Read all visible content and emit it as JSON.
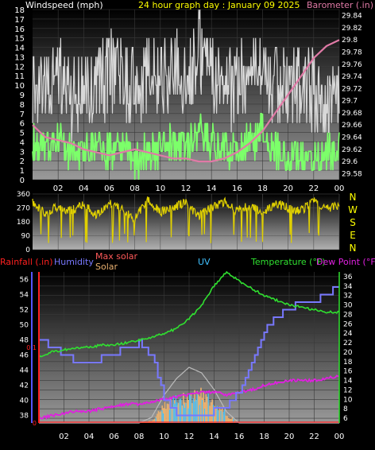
{
  "chart_data": [
    {
      "type": "line",
      "title": "24 hour graph day : January 09 2025",
      "left_axis_label": "Windspeed (mph)",
      "right_axis_label": "Barometer (.in)",
      "x_ticks": [
        "02",
        "04",
        "06",
        "08",
        "10",
        "12",
        "14",
        "16",
        "18",
        "20",
        "22",
        "00"
      ],
      "x_range_hours": [
        0,
        24
      ],
      "left_ylim": [
        0,
        18
      ],
      "left_ticks": [
        "0",
        "1",
        "2",
        "3",
        "4",
        "5",
        "6",
        "7",
        "8",
        "9",
        "10",
        "11",
        "12",
        "13",
        "14",
        "15",
        "16",
        "17",
        "18"
      ],
      "right_ylim": [
        29.57,
        29.85
      ],
      "right_ticks": [
        "29.58",
        "29.6",
        "29.62",
        "29.64",
        "29.66",
        "29.68",
        "29.7",
        "29.72",
        "29.74",
        "29.76",
        "29.78",
        "29.8",
        "29.82",
        "29.84"
      ],
      "colors": {
        "gust": "#d8d8d8",
        "wind": "#7cff6a",
        "barometer": "#e07aa6",
        "left_label": "#ffffff",
        "right_label": "#e07aa6",
        "title": "#ffff00"
      },
      "series": [
        {
          "role": "barometer",
          "values_hourly": [
            29.66,
            29.64,
            29.635,
            29.63,
            29.62,
            29.615,
            29.61,
            29.615,
            29.62,
            29.615,
            29.61,
            29.605,
            29.605,
            29.6,
            29.6,
            29.605,
            29.615,
            29.63,
            29.65,
            29.68,
            29.71,
            29.74,
            29.77,
            29.79,
            29.8
          ]
        },
        {
          "role": "wind_speed",
          "values_hourly": [
            4,
            3,
            4,
            3,
            3,
            4,
            3,
            4,
            2,
            3,
            3,
            4,
            3,
            5,
            4,
            3,
            3,
            4,
            5,
            3,
            2,
            3,
            2,
            3,
            3
          ]
        },
        {
          "role": "wind_gust",
          "values_hourly": [
            9,
            8,
            10,
            7,
            9,
            8,
            10,
            9,
            8,
            10,
            9,
            11,
            10,
            12,
            10,
            9,
            8,
            11,
            10,
            9,
            8,
            9,
            8,
            7,
            9
          ]
        }
      ]
    },
    {
      "type": "line",
      "right_axis_label": [
        "N",
        "W",
        "S",
        "E",
        "N"
      ],
      "left_ticks": [
        "360",
        "270",
        "180",
        "90",
        "0"
      ],
      "ylim": [
        0,
        360
      ],
      "color": "#e0d000",
      "series": [
        {
          "role": "wind_direction",
          "values_hourly": [
            300,
            230,
            280,
            250,
            290,
            220,
            310,
            260,
            200,
            320,
            240,
            280,
            300,
            220,
            270,
            310,
            250,
            290,
            230,
            300,
            270,
            250,
            320,
            260,
            290
          ]
        }
      ]
    },
    {
      "type": "line",
      "labels": {
        "rainfall": "Rainfall (.in)",
        "humidity": "Humidity",
        "max_solar": "Max solar",
        "solar": "Solar",
        "uv": "UV",
        "temperature": "Temperature (°F)",
        "dew_point": "Dew Point (°F)"
      },
      "x_ticks": [
        "02",
        "04",
        "06",
        "08",
        "10",
        "12",
        "14",
        "16",
        "18",
        "20",
        "22",
        "00"
      ],
      "x_range_hours": [
        0,
        24
      ],
      "humidity_ylim": [
        37,
        57
      ],
      "humidity_ticks": [
        "38",
        "40",
        "42",
        "44",
        "46",
        "48",
        "50",
        "52",
        "54",
        "56"
      ],
      "rain_ticks": [
        "0",
        "0.1"
      ],
      "rain_ylim": [
        0,
        0.2
      ],
      "temp_ylim": [
        5,
        37
      ],
      "temp_ticks": [
        "6",
        "8",
        "10",
        "12",
        "14",
        "16",
        "18",
        "20",
        "22",
        "24",
        "26",
        "28",
        "30",
        "32",
        "34",
        "36"
      ],
      "colors": {
        "rainfall": "#ff2020",
        "humidity": "#7878ff",
        "max_solar": "#ff5a5a",
        "solar": "#e8b070",
        "uv": "#40c0ff",
        "temperature": "#30e030",
        "dew_point": "#e020e0"
      },
      "series": [
        {
          "role": "temperature",
          "values_hourly": [
            19,
            20,
            20.5,
            21,
            21,
            21.5,
            21.5,
            22,
            22.5,
            23,
            24,
            25,
            27,
            30,
            34,
            37,
            35,
            33.5,
            32,
            31,
            30,
            29.5,
            29,
            28.5,
            28.5
          ]
        },
        {
          "role": "humidity",
          "values_hourly": [
            48,
            47,
            46,
            45,
            45,
            45.5,
            46,
            47,
            47.5,
            46,
            40,
            38,
            38,
            38,
            38.5,
            39,
            41,
            45,
            49,
            51,
            52,
            53,
            53,
            54,
            55
          ]
        },
        {
          "role": "dew_point",
          "values_hourly": [
            6,
            6.5,
            7,
            7.5,
            7.5,
            8,
            8.5,
            9,
            9,
            9.5,
            10,
            10.5,
            11,
            11.5,
            11.5,
            11,
            11.5,
            12,
            13,
            13.5,
            14,
            14,
            14,
            14.5,
            15
          ]
        },
        {
          "role": "max_solar",
          "values_hourly": [
            0,
            0,
            0,
            0,
            0,
            0,
            0,
            0,
            0,
            0.1,
            0.5,
            0.8,
            1.0,
            0.9,
            0.6,
            0.2,
            0,
            0,
            0,
            0,
            0,
            0,
            0,
            0,
            0
          ]
        },
        {
          "role": "solar",
          "values_hourly": [
            0,
            0,
            0,
            0,
            0,
            0,
            0,
            0,
            0,
            0.05,
            0.35,
            0.45,
            0.5,
            0.55,
            0.4,
            0.15,
            0,
            0,
            0,
            0,
            0,
            0,
            0,
            0,
            0
          ]
        },
        {
          "role": "uv",
          "values_hourly": [
            0,
            0,
            0,
            0,
            0,
            0,
            0,
            0,
            0,
            0,
            0.3,
            0.4,
            0.5,
            0.5,
            0.4,
            0.15,
            0,
            0,
            0,
            0,
            0,
            0,
            0,
            0,
            0
          ]
        },
        {
          "role": "rainfall",
          "values_hourly": [
            0,
            0,
            0,
            0,
            0,
            0,
            0,
            0,
            0,
            0,
            0,
            0,
            0,
            0,
            0,
            0,
            0,
            0,
            0,
            0,
            0,
            0,
            0,
            0,
            0
          ]
        }
      ]
    }
  ]
}
